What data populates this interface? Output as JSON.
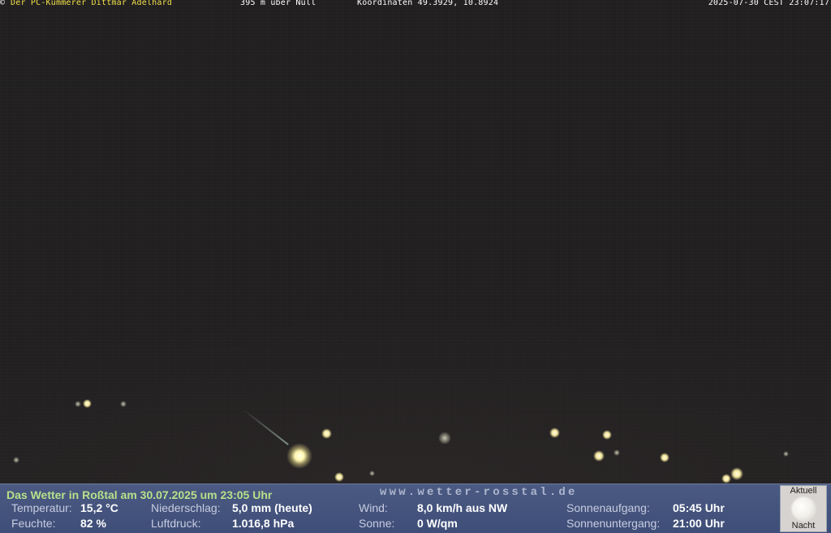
{
  "overlay": {
    "copyright_symbol": "©",
    "owner": "Der PC-Kümmerer Dittmar Adelhard",
    "altitude": "395 m über Null",
    "coordinates": "Koordinaten 49.3929, 10.8924",
    "timestamp": "2025-07-30 CEST 23:07:17"
  },
  "weather": {
    "headline": "Das Wetter in Roßtal am 30.07.2025 um 23:05 Uhr",
    "website": "www.wetter-rosstal.de",
    "temperature_label": "Temperatur:",
    "temperature_value": "15,2 °C",
    "humidity_label": "Feuchte:",
    "humidity_value": "82 %",
    "precip_label": "Niederschlag:",
    "precip_value": "5,0 mm (heute)",
    "pressure_label": "Luftdruck:",
    "pressure_value": "1.016,8 hPa",
    "wind_label": "Wind:",
    "wind_value": "8,0 km/h aus NW",
    "sun_label": "Sonne:",
    "sun_value": "0 W/qm",
    "sunrise_label": "Sonnenaufgang:",
    "sunrise_value": "05:45 Uhr",
    "sunset_label": "Sonnenuntergang:",
    "sunset_value": "21:00 Uhr"
  },
  "moon": {
    "top_label": "Aktuell",
    "bottom_label": "Nacht",
    "icon": "full-moon-icon"
  },
  "colors": {
    "owner_text": "#f2e04a",
    "headline_text": "#b7e08a",
    "panel_background": "#4a5a82"
  }
}
